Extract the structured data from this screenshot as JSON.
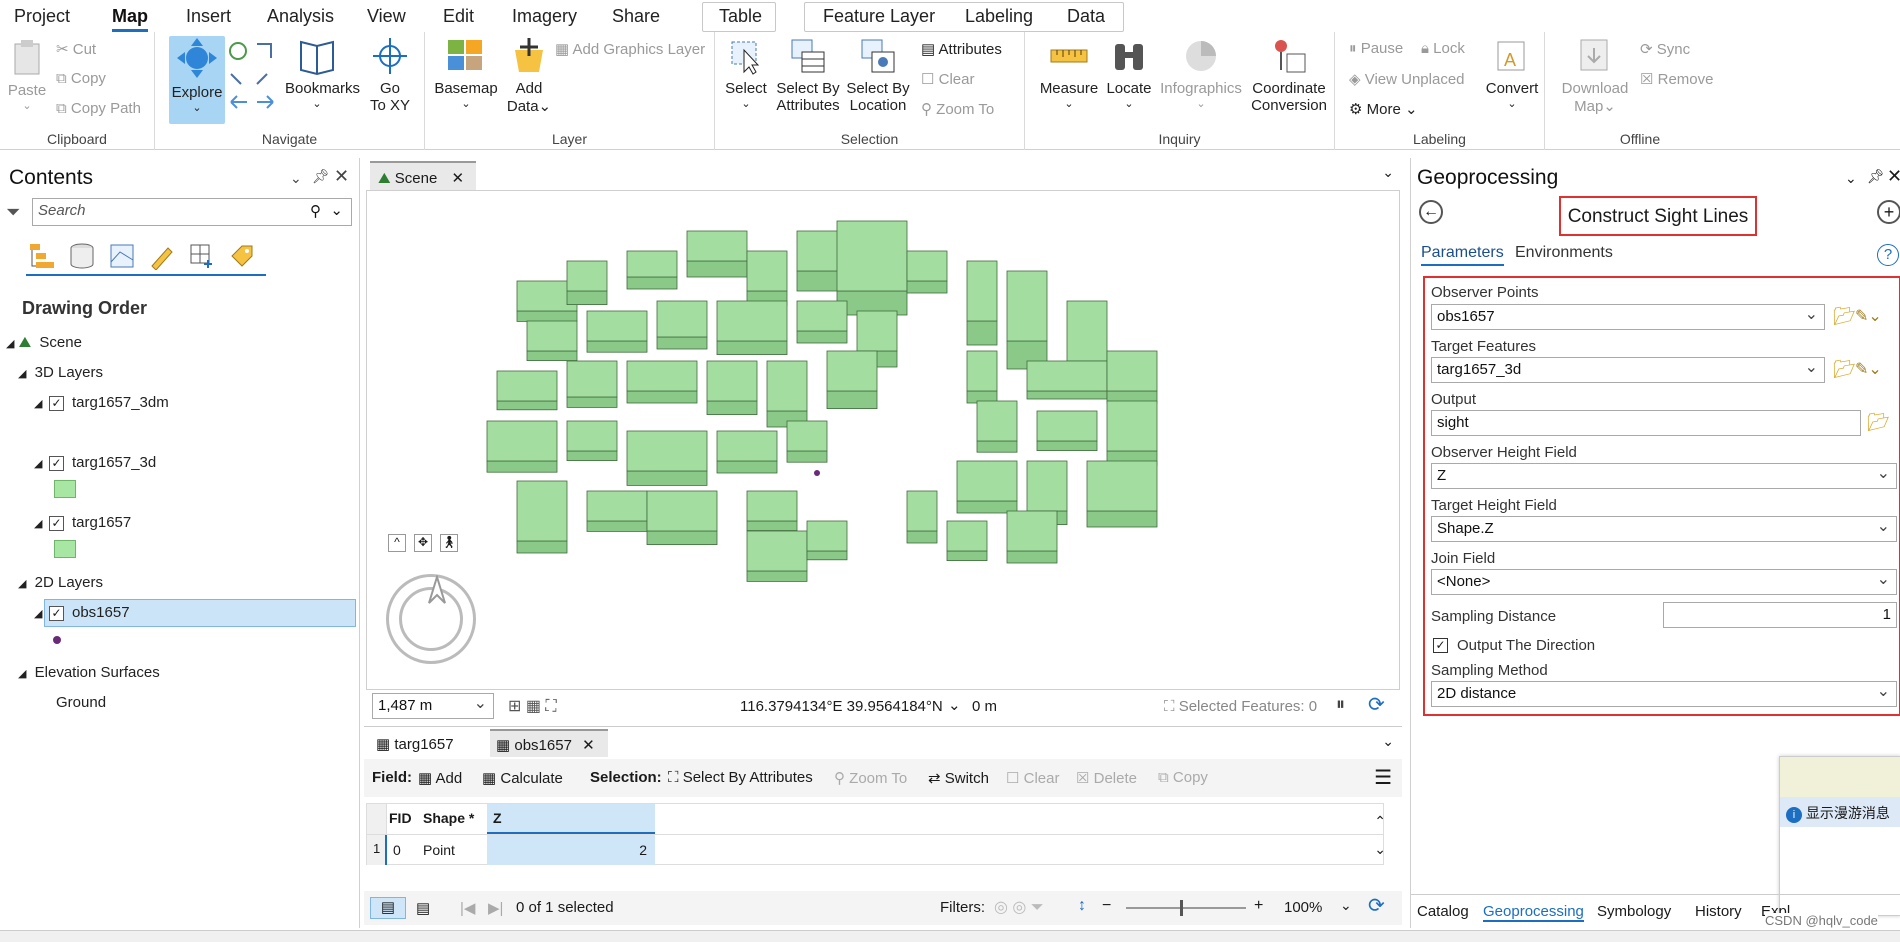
{
  "menu_tabs": [
    "Project",
    "Map",
    "Insert",
    "Analysis",
    "View",
    "Edit",
    "Imagery",
    "Share"
  ],
  "active_tab": "Map",
  "context_tabs": {
    "table": "Table",
    "feature_layer": "Feature Layer",
    "labeling": "Labeling",
    "data": "Data"
  },
  "ribbon": {
    "clipboard": {
      "name": "Clipboard",
      "paste": "Paste",
      "cut": "Cut",
      "copy": "Copy",
      "copy_path": "Copy Path"
    },
    "navigate": {
      "name": "Navigate",
      "explore": "Explore",
      "bookmarks": "Bookmarks",
      "goto": "Go\nTo XY",
      "go": "Go",
      "toxy": "To XY"
    },
    "layer": {
      "name": "Layer",
      "basemap": "Basemap",
      "add": "Add",
      "data": "Data",
      "add_graphics": "Add Graphics Layer"
    },
    "selection": {
      "name": "Selection",
      "select": "Select",
      "select_by_attr_1": "Select By",
      "select_by_attr_2": "Attributes",
      "select_by_loc_1": "Select By",
      "select_by_loc_2": "Location",
      "attributes": "Attributes",
      "clear": "Clear",
      "zoom_to": "Zoom To"
    },
    "inquiry": {
      "name": "Inquiry",
      "measure": "Measure",
      "locate": "Locate",
      "infographics": "Infographics",
      "coord_1": "Coordinate",
      "coord_2": "Conversion"
    },
    "labeling": {
      "name": "Labeling",
      "pause": "Pause",
      "lock": "Lock",
      "view_unplaced": "View Unplaced",
      "more": "More",
      "convert": "Convert"
    },
    "offline": {
      "name": "Offline",
      "download_1": "Download",
      "download_2": "Map",
      "sync": "Sync",
      "remove": "Remove"
    }
  },
  "contents": {
    "title": "Contents",
    "search_placeholder": "Search",
    "drawing_order": "Drawing Order",
    "scene": "Scene",
    "layers_3d": "3D Layers",
    "layer_targ_3dm": "targ1657_3dm",
    "layer_targ_3d": "targ1657_3d",
    "layer_targ": "targ1657",
    "layers_2d": "2D Layers",
    "layer_obs": "obs1657",
    "elevation": "Elevation Surfaces",
    "ground": "Ground",
    "swatch_color": "#a8e6a3",
    "point_color": "#6a2a7a"
  },
  "scene_view": {
    "tab": "Scene",
    "scale": "1,487 m",
    "coords": "116.3794134°E 39.9564184°N",
    "elevation": "0 m",
    "selected": "Selected Features: 0",
    "building_color": "#a3dea0"
  },
  "table": {
    "tabs": [
      "targ1657",
      "obs1657"
    ],
    "field_label": "Field:",
    "add": "Add",
    "calculate": "Calculate",
    "selection_label": "Selection:",
    "select_by_attr": "Select By Attributes",
    "zoom_to": "Zoom To",
    "switch": "Switch",
    "clear": "Clear",
    "delete": "Delete",
    "copy": "Copy",
    "columns": [
      "FID",
      "Shape *",
      "Z"
    ],
    "rows": [
      {
        "num": "1",
        "fid": "0",
        "shape": "Point",
        "z": "2"
      }
    ],
    "selected_text": "0 of 1 selected",
    "filters": "Filters:",
    "zoom": "100%"
  },
  "geoprocessing": {
    "title": "Geoprocessing",
    "tool": "Construct Sight Lines",
    "tab_params": "Parameters",
    "tab_env": "Environments",
    "observer_points_label": "Observer Points",
    "observer_points": "obs1657",
    "target_features_label": "Target Features",
    "target_features": "targ1657_3d",
    "output_label": "Output",
    "output": "sight",
    "obs_height_label": "Observer Height Field",
    "obs_height": "Z",
    "target_height_label": "Target Height Field",
    "target_height": "Shape.Z",
    "join_label": "Join Field",
    "join": "<None>",
    "sampling_distance_label": "Sampling Distance",
    "sampling_distance": "1",
    "output_direction": "Output The Direction",
    "sampling_method_label": "Sampling Method",
    "sampling_method": "2D distance",
    "highlight_color": "#e03131"
  },
  "bottom_tabs": [
    "Catalog",
    "Geoprocessing",
    "Symbology",
    "History",
    "Expl"
  ],
  "popup": {
    "text": "显示漫游消息"
  },
  "watermark": "CSDN @hqlv_code"
}
